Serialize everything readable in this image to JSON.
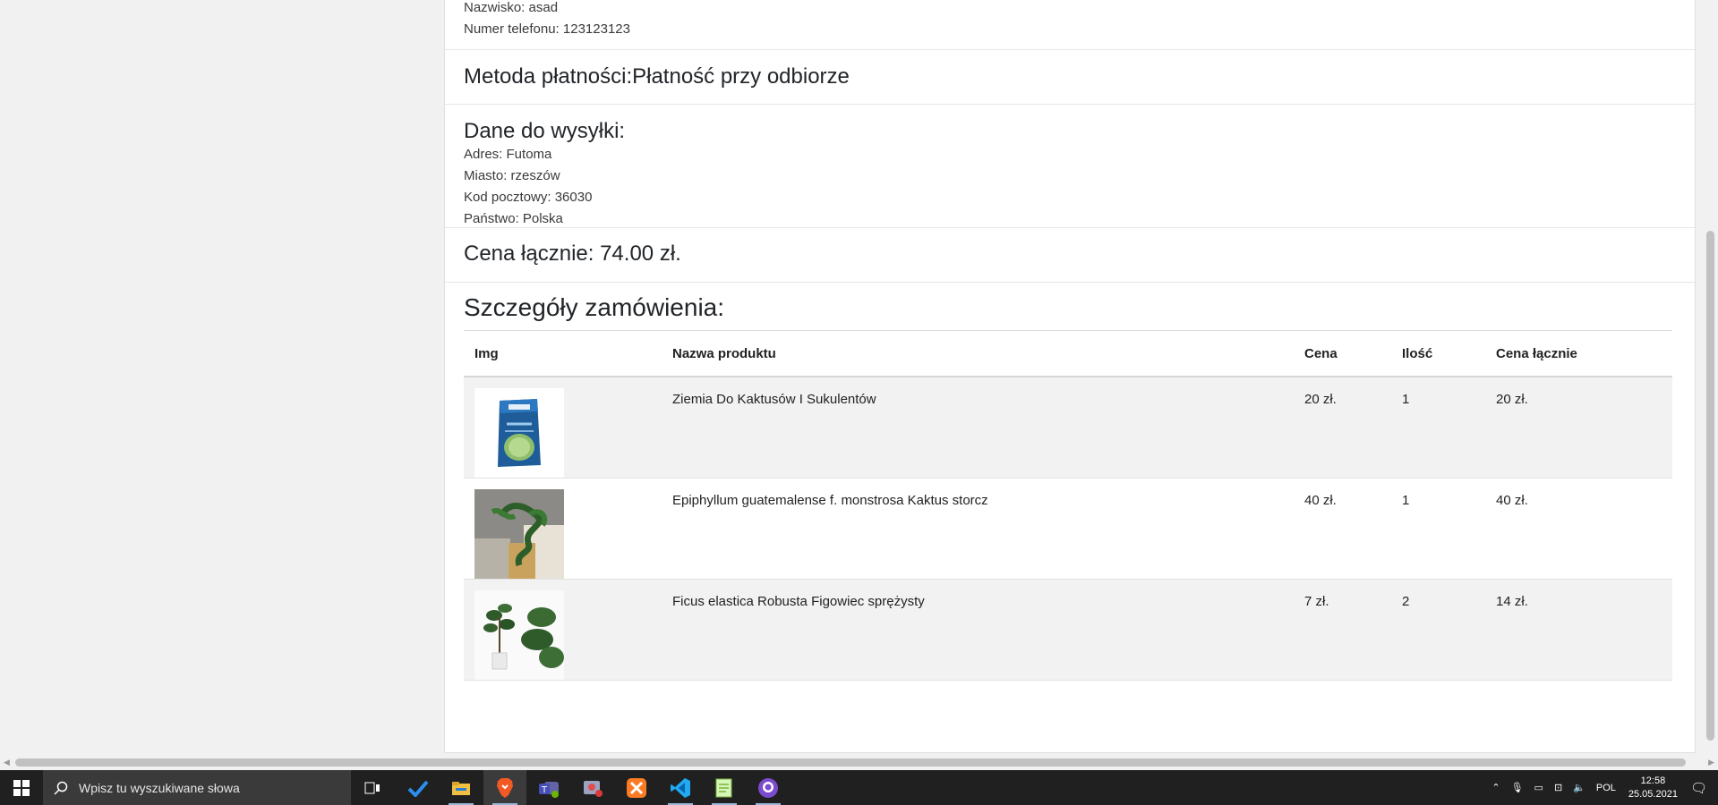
{
  "customer": {
    "surname_line": "Nazwisko: asad",
    "phone_line": "Numer telefonu: 123123123"
  },
  "payment": {
    "heading": "Metoda płatności:Płatność przy odbiorze"
  },
  "shipping": {
    "heading": "Dane do wysyłki:",
    "address": "Adres: Futoma",
    "city": "Miasto: rzeszów",
    "postal": "Kod pocztowy: 36030",
    "country": "Państwo: Polska"
  },
  "total": {
    "heading": "Cena łącznie: 74.00 zł."
  },
  "details": {
    "heading": "Szczegóły zamówienia:",
    "columns": {
      "img": "Img",
      "name": "Nazwa produktu",
      "price": "Cena",
      "qty": "Ilość",
      "total": "Cena łącznie"
    },
    "rows": [
      {
        "name": "Ziemia Do Kaktusów I Sukulentów",
        "price": "20 zł.",
        "qty": "1",
        "total": "20 zł."
      },
      {
        "name": "Epiphyllum guatemalense f. monstrosa Kaktus storcz",
        "price": "40 zł.",
        "qty": "1",
        "total": "40 zł."
      },
      {
        "name": "Ficus elastica Robusta Figowiec sprężysty",
        "price": "7 zł.",
        "qty": "2",
        "total": "14 zł."
      }
    ]
  },
  "taskbar": {
    "search_placeholder": "Wpisz tu wyszukiwane słowa",
    "language": "POL",
    "time": "12:58",
    "date": "25.05.2021",
    "apps": [
      "task-view-icon",
      "todo-icon",
      "file-explorer-icon",
      "brave-browser-icon",
      "teams-icon",
      "snip-icon",
      "xampp-icon",
      "vscode-icon",
      "notepad-plus-icon",
      "github-desktop-icon"
    ]
  }
}
